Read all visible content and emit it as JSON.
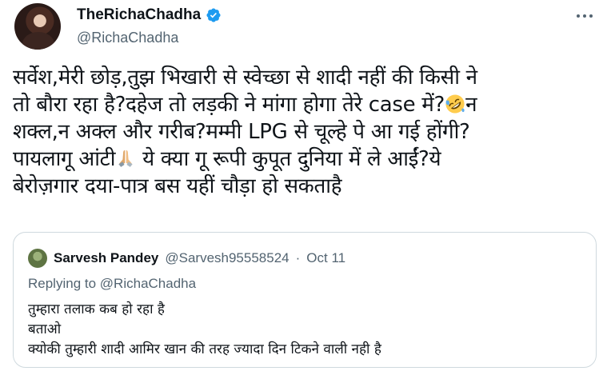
{
  "tweet": {
    "display_name": "TheRichaChadha",
    "handle": "@RichaChadha",
    "lines": [
      "सर्वेश,मेरी छोड़,तुझ भिखारी से स्वेच्छा से शादी नहीं की किसी ने",
      "तो बौरा रहा है?दहेज तो लड़की ने मांगा होगा तेरे case में?",
      "शक्ल,न अक्ल और गरीब?मम्मी LPG से चूल्हे पे आ गई होंगी?",
      "पायलागू आंटी",
      "बेरोज़गार दया-पात्र बस यहीं चौड़ा हो सकताहै"
    ],
    "line2_tail": "न",
    "line4_tail": "ये क्या गू रूपी कुपूत दुनिया में ले आईं?ये",
    "emojis": [
      "rolling-on-floor-laughing-emoji",
      "folded-hands-emoji"
    ]
  },
  "quoted": {
    "name": "Sarvesh Pandey",
    "handle": "@Sarvesh95558524",
    "dot": "·",
    "date": "Oct 11",
    "replying_prefix": "Replying to",
    "replying_mention": "@RichaChadha",
    "lines": [
      "तुम्हारा तलाक कब हो रहा है",
      "बताओ",
      "क्योकी तुम्हारी शादी आमिर खान की तरह ज्यादा दिन टिकने वाली नही है"
    ]
  },
  "colors": {
    "verified": "#1d9bf0",
    "secondary_text": "#536471",
    "border": "#cfd9de"
  }
}
